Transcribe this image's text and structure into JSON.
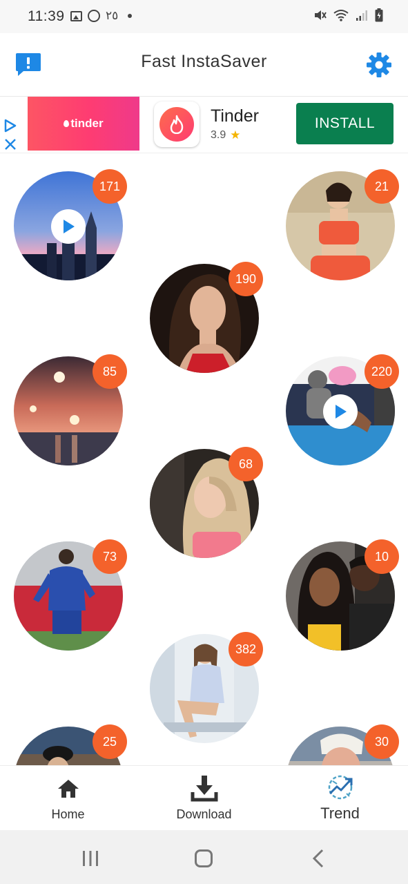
{
  "status_bar": {
    "time": "11:39",
    "extra_text": "٢٥"
  },
  "app_bar": {
    "title": "Fast InstaSaver",
    "feedback_icon": "feedback-icon",
    "settings_icon": "gear-icon",
    "accent_color": "#1e88e5"
  },
  "ad": {
    "image_text": "tinder",
    "app_name": "Tinder",
    "rating": "3.9",
    "install_label": "INSTALL",
    "install_color": "#0a7f4f"
  },
  "feed": {
    "badge_color": "#f4622b",
    "items": [
      {
        "count": "171",
        "video": true
      },
      {
        "count": "21",
        "video": false
      },
      {
        "count": "190",
        "video": false
      },
      {
        "count": "85",
        "video": false
      },
      {
        "count": "220",
        "video": true
      },
      {
        "count": "68",
        "video": false
      },
      {
        "count": "73",
        "video": false
      },
      {
        "count": "10",
        "video": false
      },
      {
        "count": "382",
        "video": false
      },
      {
        "count": "25",
        "video": false
      },
      {
        "count": "30",
        "video": false
      }
    ]
  },
  "bottom_nav": {
    "items": [
      {
        "label": "Home",
        "icon": "home-icon"
      },
      {
        "label": "Download",
        "icon": "download-icon"
      },
      {
        "label": "Trend",
        "icon": "trend-icon"
      }
    ]
  },
  "system_nav": {
    "icons": [
      "recent-apps-icon",
      "home-circle-icon",
      "back-icon"
    ]
  }
}
